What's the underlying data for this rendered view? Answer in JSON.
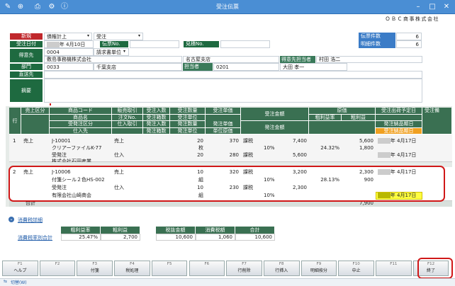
{
  "window": {
    "title": "受注伝票"
  },
  "company": "ＯＢＣ商事株式会社",
  "header": {
    "shinki": "新規",
    "kubun_a": "債権計上",
    "kubun_b": "受注",
    "juchu_date_label": "受注日付",
    "juchu_date": "年 4月10日",
    "denpyo_no_label": "伝票No.",
    "mitsumori_no_label": "見積No.",
    "denpyo_count_label": "伝票件数",
    "denpyo_count": "6",
    "meisai_count_label": "明細件数",
    "meisai_count": "6",
    "tokuisaki_label": "得意先",
    "tokuisaki_code": "0004",
    "seikyu_label": "請求書単位",
    "tokuisaki_name": "敷島事務機株式会社",
    "branch": "名古屋支店",
    "tanto_label_tok": "得意先担当者",
    "tanto_name_tok": "村田 浩二",
    "bumon_label": "部門",
    "bumon_code": "0033",
    "bumon_name": "千葉支店",
    "tantosha_label": "担当者",
    "tantosha_code": "0201",
    "tantosha_name": "大田 孝一",
    "chokuso_label": "直送先",
    "tekiyo_label": "摘要"
  },
  "grid": {
    "headers": {
      "gyo": "行",
      "uriage_kubun": "売上区分",
      "shohin_code": "商品コード",
      "shohin_name": "商品名",
      "juchu_kubun": "受発注区分",
      "shiiresaki": "仕入先",
      "hanbai_torihiki": "販売取引",
      "chumon_no": "注文No.",
      "shiire_torihiki": "仕入取引",
      "juchu_irisu": "受注入数",
      "juchu_hakosu": "受注箱数",
      "hatchu_irisu": "発注入数",
      "hatchu_hakosu": "発注箱数",
      "juchu_suryo": "受注数量",
      "juchu_tani": "受注単位",
      "hatchu_suryo": "発注数量",
      "hatchu_tani": "発注単位",
      "juchu_tanka": "受注単価",
      "hatchu_tanka": "発注単価",
      "tanka_sentei": "単位原価",
      "juchu_kingaku": "受注金額",
      "hatchu_kingaku": "発注金額",
      "genka": "原価",
      "arari_ritsu": "粗利益率",
      "arari": "粗利益",
      "shukka_date": "受注出荷予定日",
      "hatchu_nohin": "発注納品期日",
      "juchu_nohin": "受注納品期日",
      "extra": "受注備"
    },
    "rows": [
      {
        "no": "1",
        "kubun": "売上",
        "code": "J-10001",
        "name": "クリアーファイルK-77",
        "juhatchu": "受発注",
        "shiiresaki": "株式会社石田産業",
        "hanbai": "売上",
        "shiire": "仕入",
        "qty1": "20",
        "unit1": "枚",
        "qty2": "20",
        "unit2": "枚",
        "price1": "370",
        "price2": "280",
        "kazei1": "課税",
        "rate1": "10%",
        "kazei2": "課税",
        "rate2": "10%",
        "amount1": "7,400",
        "amount2": "5,600",
        "genka": "5,600",
        "arari_ritsu": "24.32%",
        "arari": "1,800",
        "date1": "年 4月17日",
        "date2": "年 4月17日"
      },
      {
        "no": "2",
        "kubun": "売上",
        "code": "J-10006",
        "name": "付箋シール２色HS-002",
        "juhatchu": "受発注",
        "shiiresaki": "有限会社山崎商会",
        "hanbai": "売上",
        "shiire": "仕入",
        "qty1": "10",
        "unit1": "組",
        "qty2": "10",
        "unit2": "組",
        "price1": "320",
        "price2": "230",
        "kazei1": "課税",
        "rate1": "10%",
        "kazei2": "課税",
        "rate2": "10%",
        "amount1": "3,200",
        "amount2": "2,300",
        "genka": "2,300",
        "arari_ritsu": "28.13%",
        "arari": "900",
        "date1": "年 4月17日",
        "date2": "年 4月17日"
      }
    ],
    "total_label": "合計",
    "total_genka": "7,900"
  },
  "tax_detail_label": "消費税詳細",
  "summary": {
    "label": "消費税率別合計",
    "arari_ritsu_h": "粗利益率",
    "arari_h": "粗利益",
    "zeinuki_h": "税抜金額",
    "shohizei_h": "消費税額",
    "gokei_h": "合計",
    "arari_ritsu": "25.47%",
    "arari": "2,700",
    "zeinuki": "10,600",
    "shohizei": "1,060",
    "gokei": "10,600"
  },
  "fkeys": [
    {
      "k": "F1",
      "label": "ヘルプ"
    },
    {
      "k": "F2",
      "label": ""
    },
    {
      "k": "F3",
      "label": "付箋"
    },
    {
      "k": "F4",
      "label": "税処理"
    },
    {
      "k": "F5",
      "label": ""
    },
    {
      "k": "F6",
      "label": ""
    },
    {
      "k": "F7",
      "label": "行削除"
    },
    {
      "k": "F8",
      "label": "行挿入"
    },
    {
      "k": "F9",
      "label": "明細按分"
    },
    {
      "k": "F10",
      "label": "中止"
    },
    {
      "k": "F11",
      "label": ""
    },
    {
      "k": "F12",
      "label": "終了"
    }
  ],
  "status": {
    "switch_label": "切替(W)"
  },
  "colors": {
    "titlebar": "#4a8ed4",
    "label_green": "#1e6a40",
    "accent_red": "#d01818",
    "highlight_yellow": "#ffff40"
  }
}
